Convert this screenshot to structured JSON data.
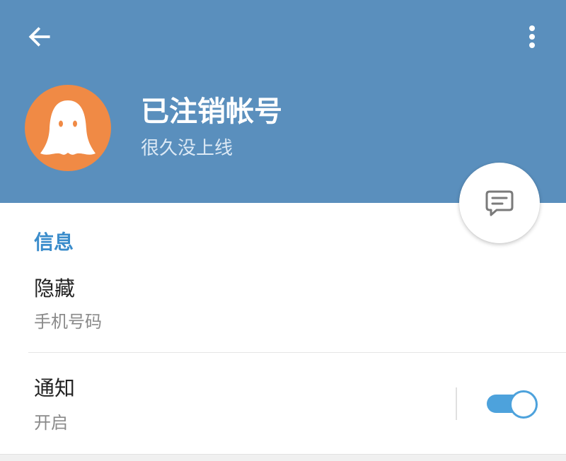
{
  "header": {
    "name": "已注销帐号",
    "status": "很久没上线",
    "back_icon": "arrow-left-icon",
    "menu_icon": "more-vertical-icon",
    "avatar_icon": "ghost-icon",
    "fab_icon": "message-icon"
  },
  "info": {
    "section_title": "信息",
    "phone": {
      "value": "隐藏",
      "label": "手机号码"
    },
    "notifications": {
      "title": "通知",
      "status": "开启",
      "enabled": true
    }
  },
  "colors": {
    "header_bg": "#5a8fbd",
    "avatar_bg": "#f08a45",
    "accent": "#3a8ccb",
    "toggle_on": "#4da2dc"
  }
}
